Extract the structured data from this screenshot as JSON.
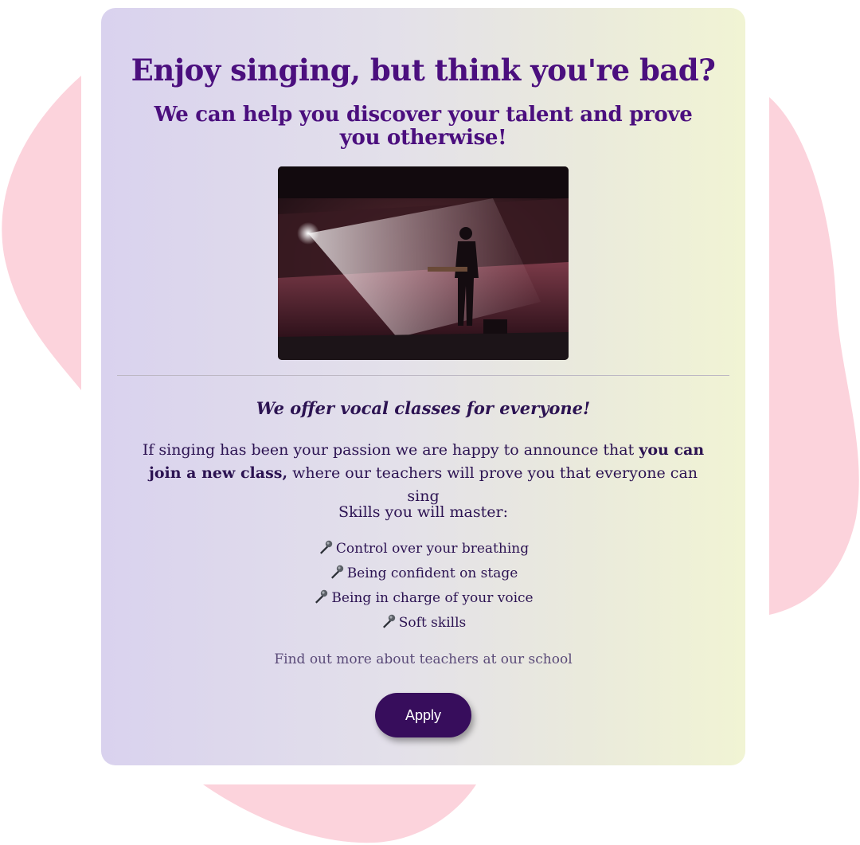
{
  "colors": {
    "heading": "#4b0f7e",
    "body_text": "#2c1352",
    "button_bg": "#370d5c",
    "button_text": "#ffffff",
    "blob": "#fcd3dc"
  },
  "hero": {
    "title": "Enjoy singing, but think you're bad?",
    "subtitle": "We can help you discover your talent and prove you otherwise!",
    "image_icon": "concert-photo"
  },
  "offer": {
    "tagline": "We offer vocal classes for everyone!",
    "intro_before": "If singing has been your passion we are happy to announce that ",
    "intro_bold": "you can join a new class,",
    "intro_after": " where our teachers will prove you that everyone can sing"
  },
  "skills": {
    "heading": "Skills you will master:",
    "bullet_icon": "microphone-icon",
    "items": [
      "Control over your breathing",
      "Being confident on stage",
      "Being in charge of your voice",
      "Soft skills"
    ]
  },
  "links": {
    "teachers": "Find out more about teachers at our school"
  },
  "actions": {
    "apply_label": "Apply"
  }
}
